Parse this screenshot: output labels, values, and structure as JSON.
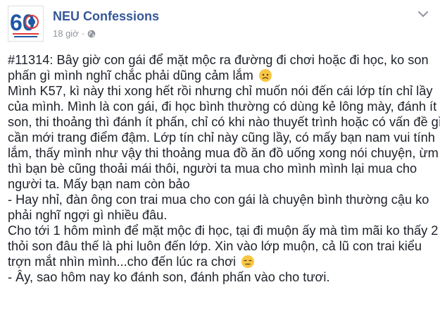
{
  "page": {
    "name": "NEU Confessions",
    "time": "18 giờ",
    "separator": "·",
    "privacy_icon": "globe-icon",
    "menu_icon": "chevron-down-icon",
    "avatar_logo_text": "60"
  },
  "post": {
    "lines": [
      "#11314: Bây giờ con gái để mặt mộc ra đường đi chơi hoặc đi học, ko son",
      "phấn gì mình nghĩ chắc phải dũng cảm lắm",
      "Mình K57, kì này thi xong hết rồi nhưng chỉ muốn nói đến cái lớp tín chỉ lầy",
      "của mình. Mình là con gái, đi học bình thường có dùng kẻ lông mày, đánh ít",
      "son, thi thoảng thì đánh ít phấn, chỉ có khi nào thuyết trình hoặc có vấn đề gì",
      "cần mới trang điểm đậm. Lớp tín chỉ này cũng lầy, có mấy bạn nam vui tính",
      "lắm, thấy mình như vậy thi thoảng mua đồ ăn đồ uống xong nói chuyện, ừm",
      "thì bạn bè cũng thoải mái thôi, người ta mua cho mình mình lại mua cho",
      "người ta. Mấy bạn nam còn bảo",
      "- Hay nhỉ, đàn ông con trai mua cho con gái là chuyện bình thường cậu ko",
      "phải nghĩ ngợi gì nhiều đâu.",
      "Cho tới 1 hôm mình để mặt mộc đi học, tại đi muộn ấy mà tìm mãi ko thấy 2",
      "thỏi son đâu thế là phi luôn đến lớp. Xin vào lớp muộn, cả lũ con trai kiểu",
      "trợn mắt nhìn mình...cho đến lúc ra chơi",
      "- Ây, sao hôm nay ko đánh son, đánh phấn vào cho tươi."
    ],
    "emojis": [
      "worried-face-emoji",
      "expressionless-face-emoji"
    ]
  },
  "colors": {
    "page_name": "#365899",
    "meta": "#90949c",
    "text": "#1d2129",
    "logo_blue": "#1e58a5",
    "logo_red": "#e03a3a"
  }
}
